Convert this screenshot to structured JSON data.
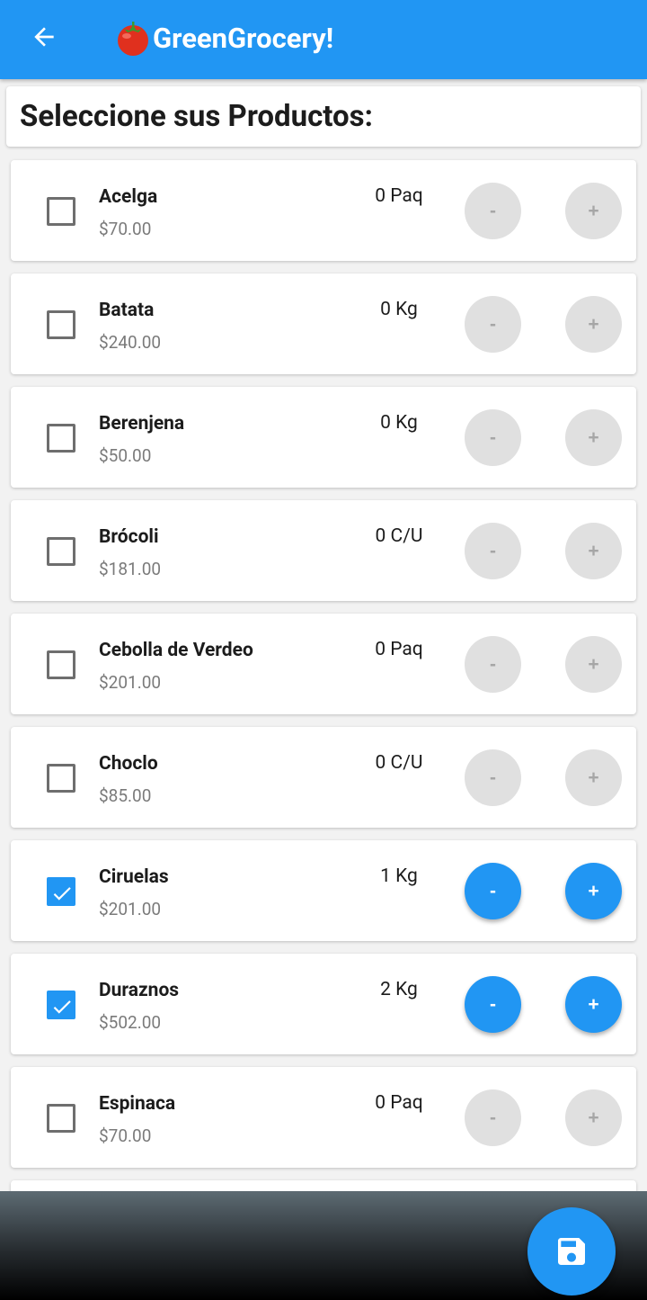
{
  "appbar": {
    "title": "GreenGrocery!",
    "title_icon": "tomato-emoji",
    "back_icon": "arrow-left-icon"
  },
  "header": {
    "title": "Seleccione sus Productos:"
  },
  "buttons": {
    "minus_label": "-",
    "plus_label": "+"
  },
  "colors": {
    "primary": "#2196f3",
    "disabled_button": "#e0e0e0"
  },
  "products": [
    {
      "name": "Acelga",
      "price": "$70.00",
      "qty": "0 Paq",
      "checked": false
    },
    {
      "name": "Batata",
      "price": "$240.00",
      "qty": "0 Kg",
      "checked": false
    },
    {
      "name": "Berenjena",
      "price": "$50.00",
      "qty": "0 Kg",
      "checked": false
    },
    {
      "name": "Brócoli",
      "price": "$181.00",
      "qty": "0 C/U",
      "checked": false
    },
    {
      "name": "Cebolla de Verdeo",
      "price": "$201.00",
      "qty": "0 Paq",
      "checked": false
    },
    {
      "name": "Choclo",
      "price": "$85.00",
      "qty": "0 C/U",
      "checked": false
    },
    {
      "name": "Ciruelas",
      "price": "$201.00",
      "qty": "1 Kg",
      "checked": true
    },
    {
      "name": "Duraznos",
      "price": "$502.00",
      "qty": "2 Kg",
      "checked": true
    },
    {
      "name": "Espinaca",
      "price": "$70.00",
      "qty": "0 Paq",
      "checked": false
    }
  ],
  "fab": {
    "icon": "save-icon"
  }
}
